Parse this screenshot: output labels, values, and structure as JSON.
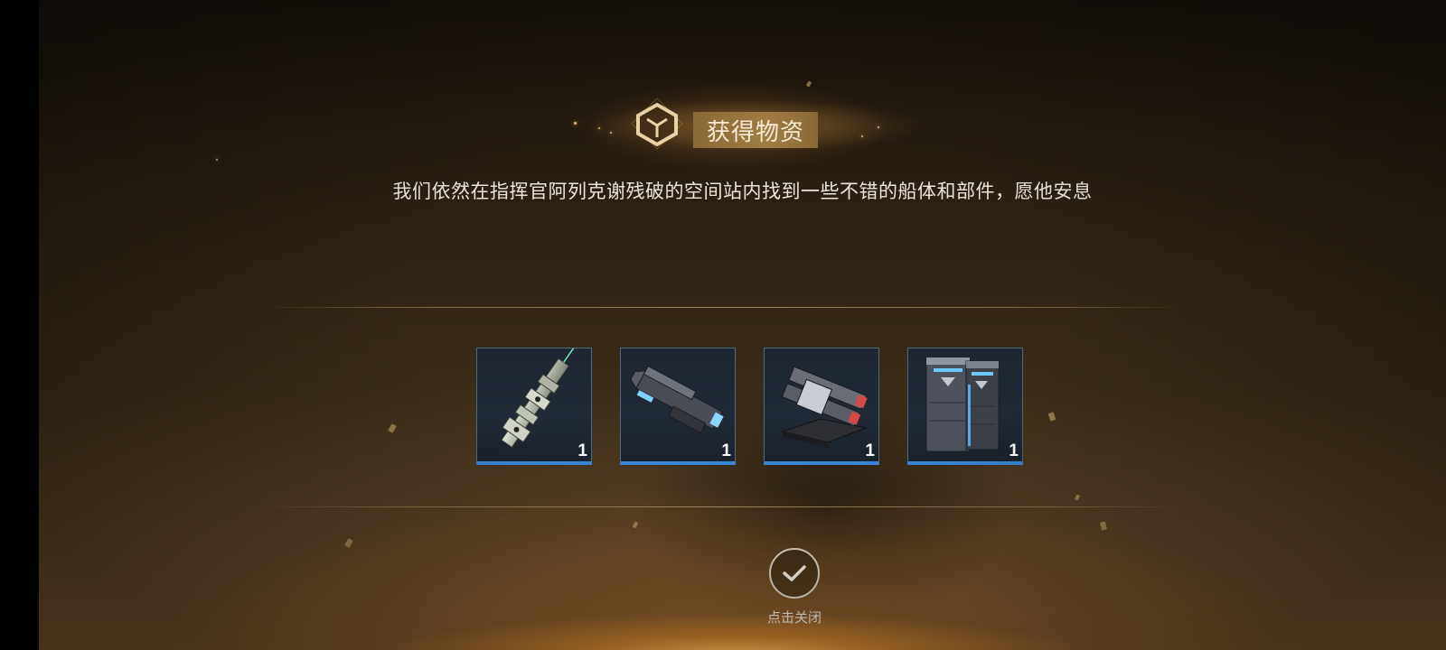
{
  "header": {
    "title": "获得物资",
    "badge_icon": "cube-hexagon-icon"
  },
  "message": "我们依然在指挥官阿列克谢残破的空间站内找到一些不错的船体和部件，愿他安息",
  "rewards": [
    {
      "icon": "ship-hull-icon",
      "quantity": "1"
    },
    {
      "icon": "cannon-module-icon",
      "quantity": "1"
    },
    {
      "icon": "twin-turret-icon",
      "quantity": "1"
    },
    {
      "icon": "armor-panel-icon",
      "quantity": "1"
    }
  ],
  "close": {
    "icon": "checkmark-icon",
    "label": "点击关闭"
  },
  "colors": {
    "accent_gold": "#a07c42",
    "card_border_blue": "#3a86d6",
    "text_light": "#ece6da"
  }
}
